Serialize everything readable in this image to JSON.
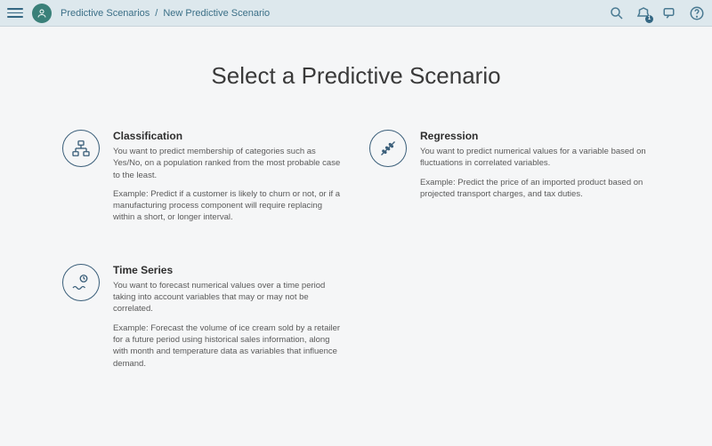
{
  "header": {
    "breadcrumb_parent": "Predictive Scenarios",
    "breadcrumb_sep": "/",
    "breadcrumb_current": "New Predictive Scenario",
    "notification_badge": "1"
  },
  "page": {
    "title": "Select a Predictive Scenario"
  },
  "scenarios": {
    "classification": {
      "title": "Classification",
      "desc": "You want to predict membership of categories such as Yes/No, on a population ranked from the most probable case to the least.",
      "example": "Example: Predict if a customer is likely to churn or not, or if a manufacturing process component will require replacing within a short, or longer interval."
    },
    "regression": {
      "title": "Regression",
      "desc": "You want to predict numerical values for a variable based on fluctuations in correlated variables.",
      "example": "Example: Predict the price of an imported product based on projected transport charges, and tax duties."
    },
    "time_series": {
      "title": "Time Series",
      "desc": "You want to forecast numerical values over a time period taking into account variables that may or may not be correlated.",
      "example": "Example: Forecast the volume of ice cream sold by a retailer for a future period using historical sales information, along with month and temperature data as variables that influence demand."
    }
  }
}
